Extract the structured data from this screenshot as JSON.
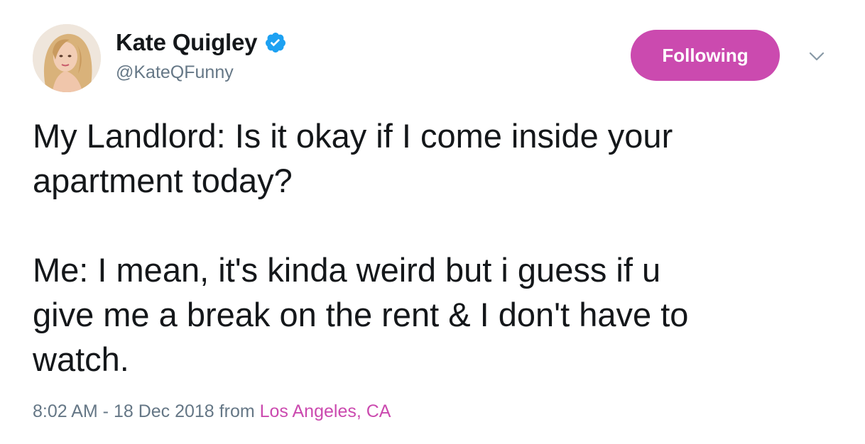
{
  "user": {
    "display_name": "Kate Quigley",
    "handle": "@KateQFunny",
    "verified": true,
    "avatar_icon": "profile-photo"
  },
  "follow_button": {
    "label": "Following",
    "color": "#cb4aaf"
  },
  "menu": {
    "icon": "chevron-down-icon"
  },
  "tweet": {
    "text": "My Landlord: Is it okay if I come inside your\napartment today?\n\nMe: I mean, it's kinda weird but i guess if u\ngive me a break on the rent & I don't have to\nwatch."
  },
  "meta": {
    "timestamp": "8:02 AM - 18 Dec 2018",
    "from_label": "from",
    "location": "Los Angeles, CA"
  },
  "colors": {
    "accent": "#cb4aaf",
    "text": "#14171a",
    "secondary": "#657786",
    "verified": "#1da1f2"
  }
}
